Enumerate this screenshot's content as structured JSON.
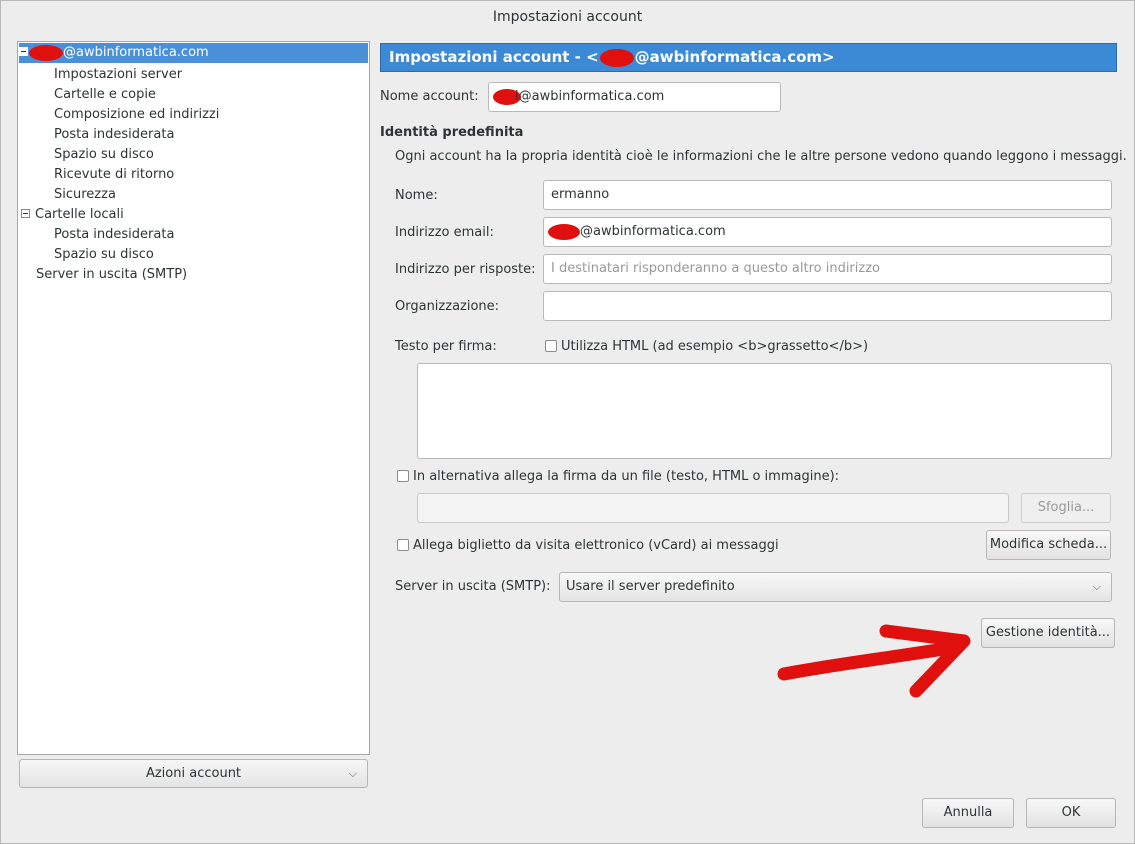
{
  "window": {
    "title": "Impostazioni account"
  },
  "sidebar": {
    "account_email": "@awbinformatica.com",
    "account_items": [
      "Impostazioni server",
      "Cartelle e copie",
      "Composizione ed indirizzi",
      "Posta indesiderata",
      "Spazio su disco",
      "Ricevute di ritorno",
      "Sicurezza"
    ],
    "local_folders": "Cartelle locali",
    "local_items": [
      "Posta indesiderata",
      "Spazio su disco"
    ],
    "smtp": "Server in uscita (SMTP)",
    "actions_button": "Azioni account"
  },
  "main": {
    "header_prefix": "Impostazioni account - <",
    "header_suffix": "@awbinformatica.com>",
    "account_name_label": "Nome account:",
    "account_name_value": "i@awbinformatica.com",
    "identity_heading": "Identità predefinita",
    "identity_desc": "Ogni account ha la propria identità cioè le informazioni che le altre persone vedono quando leggono i messaggi.",
    "name_label": "Nome:",
    "name_value": "ermanno",
    "email_label": "Indirizzo email:",
    "email_value": "@awbinformatica.com",
    "reply_label": "Indirizzo per risposte:",
    "reply_placeholder": "I destinatari risponderanno a questo altro indirizzo",
    "org_label": "Organizzazione:",
    "signature_label": "Testo per firma:",
    "use_html_label": "Utilizza HTML (ad esempio <b>grassetto</b>)",
    "attach_sig_label": "In alternativa allega la firma da un file (testo, HTML o immagine):",
    "browse_button": "Sfoglia...",
    "vcard_label": "Allega biglietto da visita elettronico (vCard) ai messaggi",
    "edit_card_button": "Modifica scheda...",
    "smtp_label": "Server in uscita (SMTP):",
    "smtp_value": "Usare il server predefinito",
    "manage_identities_button": "Gestione identità..."
  },
  "footer": {
    "cancel": "Annulla",
    "ok": "OK"
  },
  "colors": {
    "selection": "#4a90d9",
    "header": "#3c8ad5",
    "annotation": "#e0100f"
  },
  "icons": {
    "expander": "collapse-icon",
    "dropdown": "chevron-down-icon",
    "annotation": "red-arrow"
  }
}
